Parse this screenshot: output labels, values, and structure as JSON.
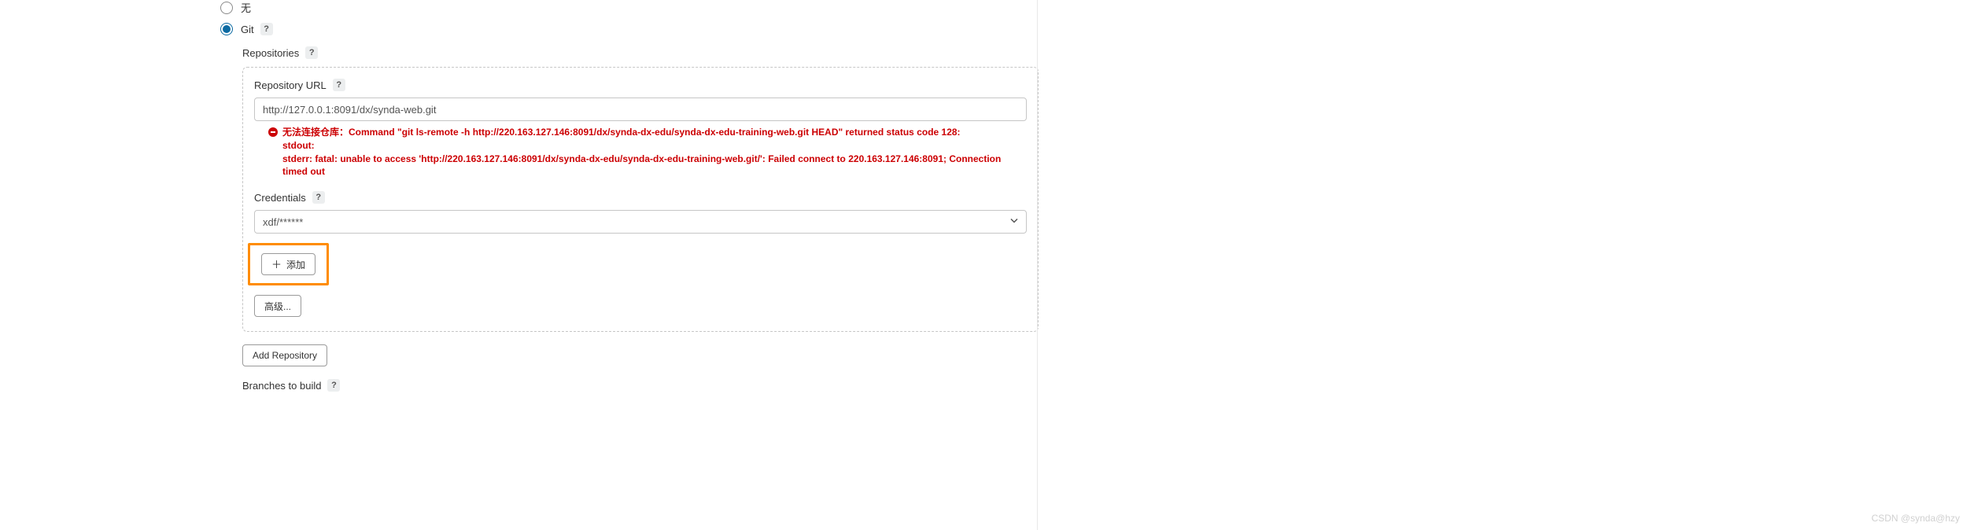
{
  "scm": {
    "options": {
      "none": {
        "label": "无"
      },
      "git": {
        "label": "Git"
      }
    },
    "selected": "git"
  },
  "repositories": {
    "label": "Repositories",
    "repo": {
      "url_label": "Repository URL",
      "url_value": "http://127.0.0.1:8091/dx/synda-web.git",
      "error_line1": "无法连接仓库：Command \"git ls-remote -h http://220.163.127.146:8091/dx/synda-dx-edu/synda-dx-edu-training-web.git HEAD\" returned status code 128:",
      "error_line2": "stdout:",
      "error_line3": "stderr: fatal: unable to access 'http://220.163.127.146:8091/dx/synda-dx-edu/synda-dx-edu-training-web.git/': Failed connect to 220.163.127.146:8091; Connection timed out",
      "credentials_label": "Credentials",
      "credentials_value": "xdf/******",
      "add_cred_button": "添加",
      "advanced_button": "高级..."
    },
    "add_repo_button": "Add Repository"
  },
  "branches": {
    "label": "Branches to build"
  },
  "watermark": "CSDN @synda@hzy"
}
